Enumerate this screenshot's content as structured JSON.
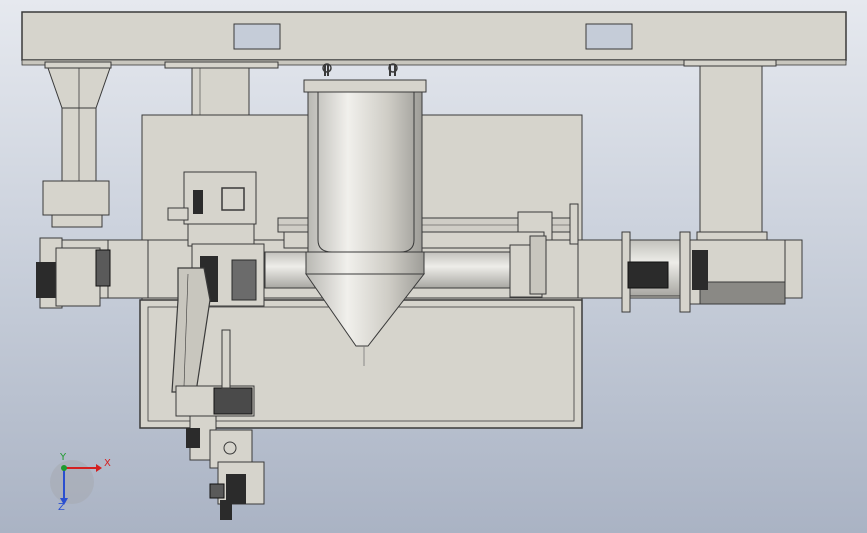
{
  "viewport": {
    "background_top": "#e6e9ef",
    "background_bottom": "#aab3c4",
    "model_fill": "#d6d4cc",
    "model_edge": "#3a3a3a",
    "dark_part": "#2b2b2b"
  },
  "triad": {
    "x_label": "X",
    "y_label": "Y",
    "z_label": "Z",
    "x_color": "#d42020",
    "y_color": "#1e9a2e",
    "z_color": "#2a4fd0"
  }
}
